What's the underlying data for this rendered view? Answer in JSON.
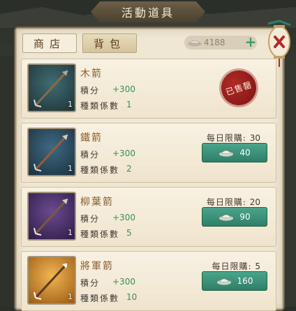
{
  "header": {
    "title": "活動道具"
  },
  "tabs": [
    {
      "label": "商店"
    },
    {
      "label": "背包"
    }
  ],
  "currency": {
    "value": "4188",
    "icon": "silver-ingot-icon"
  },
  "labels": {
    "points": "積分",
    "coefficient": "種類係數"
  },
  "items": [
    {
      "name": "木箭",
      "points": "+300",
      "coefficient": "1",
      "qty": "1",
      "status": "已售罄",
      "thumb_color": "#2c4c54"
    },
    {
      "name": "鐵箭",
      "points": "+300",
      "coefficient": "2",
      "qty": "1",
      "limit_label": "每日限購:",
      "limit": "30",
      "price": "40",
      "thumb_color": "#2a4b60"
    },
    {
      "name": "柳葉箭",
      "points": "+300",
      "coefficient": "5",
      "qty": "1",
      "limit_label": "每日限購:",
      "limit": "20",
      "price": "90",
      "thumb_color": "#4a2f66"
    },
    {
      "name": "將軍箭",
      "points": "+300",
      "coefficient": "10",
      "qty": "1",
      "limit_label": "每日限購:",
      "limit": "5",
      "price": "160",
      "thumb_color": "#c87a1f"
    }
  ],
  "colors": {
    "accent_green": "#3c8e57",
    "button_teal": "#2f7f67",
    "seal_red": "#9c1f1b"
  }
}
